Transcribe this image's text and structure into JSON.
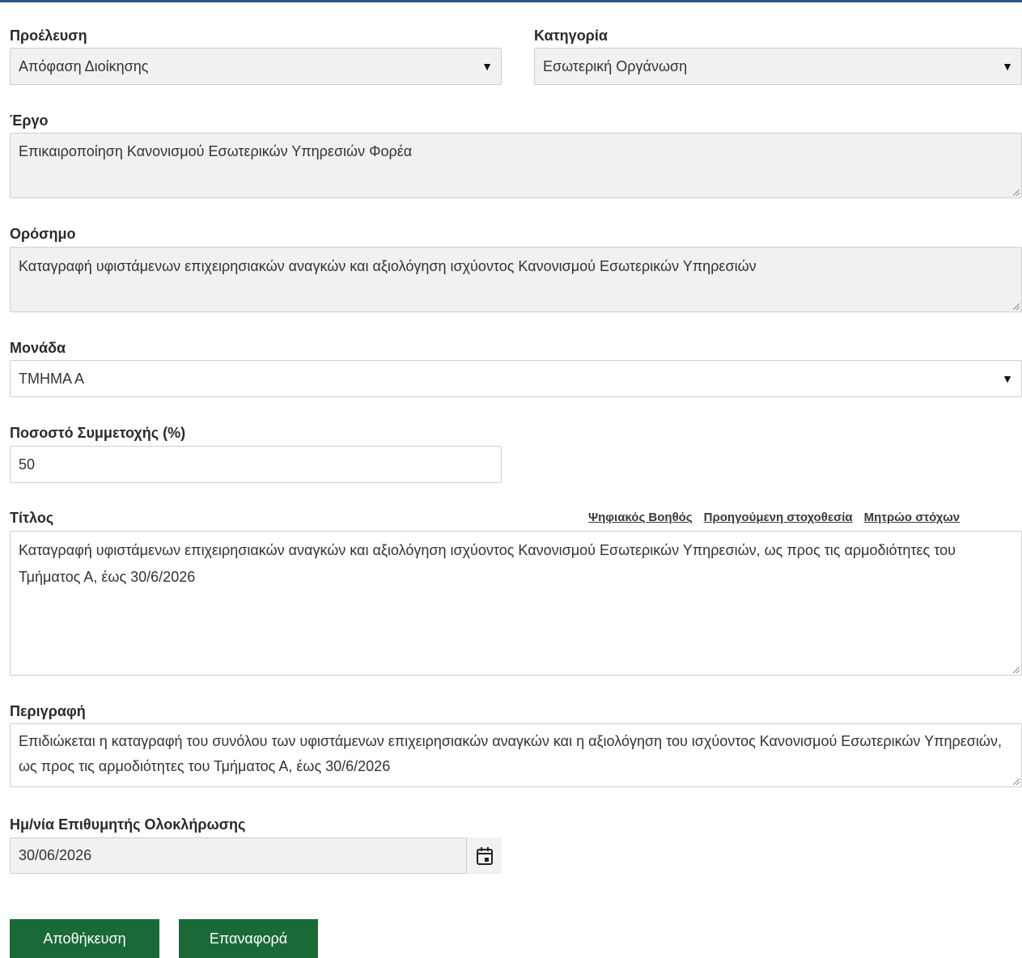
{
  "form": {
    "origin": {
      "label": "Προέλευση",
      "value": "Απόφαση Διοίκησης"
    },
    "category": {
      "label": "Κατηγορία",
      "value": "Εσωτερική Οργάνωση"
    },
    "project": {
      "label": "Έργο",
      "value": "Επικαιροποίηση Κανονισμού Εσωτερικών Υπηρεσιών Φορέα"
    },
    "milestone": {
      "label": "Ορόσημο",
      "value": "Καταγραφή υφιστάμενων επιχειρησιακών αναγκών και αξιολόγηση ισχύοντος Κανονισμού Εσωτερικών Υπηρεσιών"
    },
    "unit": {
      "label": "Μονάδα",
      "value": "ΤΜΗΜΑ Α"
    },
    "participation": {
      "label": "Ποσοστό Συμμετοχής (%)",
      "value": "50"
    },
    "title": {
      "label": "Τίτλος",
      "value": "Καταγραφή υφιστάμενων επιχειρησιακών αναγκών και αξιολόγηση ισχύοντος Κανονισμού Εσωτερικών Υπηρεσιών, ως προς τις αρμοδιότητες του Τμήματος Α, έως 30/6/2026",
      "links": [
        "Ψηφιακός Βοηθός",
        "Προηγούμενη στοχοθεσία",
        "Μητρώο στόχων"
      ]
    },
    "description": {
      "label": "Περιγραφή",
      "value": "Επιδιώκεται η καταγραφή του συνόλου των υφιστάμενων επιχειρησιακών αναγκών και η αξιολόγηση του ισχύοντος Κανονισμού Εσωτερικών Υπηρεσιών, ως προς τις αρμοδιότητες του Τμήματος Α, έως 30/6/2026"
    },
    "due_date": {
      "label": "Ημ/νία Επιθυμητής Ολοκλήρωσης",
      "value": "30/06/2026"
    }
  },
  "buttons": {
    "save": "Αποθήκευση",
    "reset": "Επαναφορά"
  },
  "icons": {
    "dropdown": "caret-down-icon",
    "calendar": "calendar-icon"
  },
  "colors": {
    "accent_line": "#2f5687",
    "button_bg": "#1a6a38",
    "field_bg": "#f1f1f1"
  }
}
